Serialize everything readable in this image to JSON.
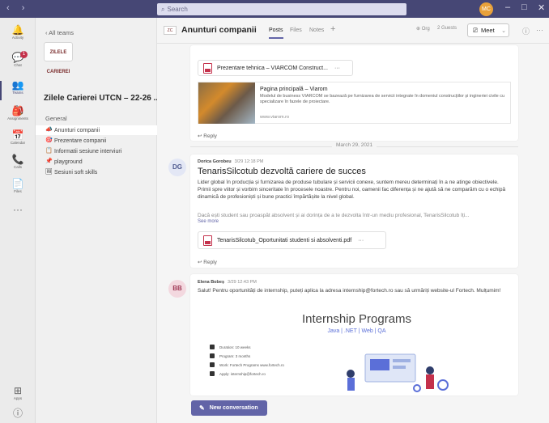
{
  "titlebar": {
    "search_placeholder": "Search",
    "user_initials": "MC"
  },
  "rail": [
    {
      "icon": "bell-icon",
      "glyph": "🔔",
      "label": "Activity"
    },
    {
      "icon": "chat-icon",
      "glyph": "💬",
      "label": "Chat",
      "badge": "1"
    },
    {
      "icon": "teams-icon",
      "glyph": "👥",
      "label": "Teams",
      "active": true
    },
    {
      "icon": "assignments-icon",
      "glyph": "🎒",
      "label": "Assignments"
    },
    {
      "icon": "calendar-icon",
      "glyph": "📅",
      "label": "Calendar"
    },
    {
      "icon": "calls-icon",
      "glyph": "📞",
      "label": "Calls"
    },
    {
      "icon": "files-icon",
      "glyph": "📄",
      "label": "Files"
    },
    {
      "icon": "more-icon",
      "glyph": "···",
      "label": ""
    },
    {
      "icon": "apps-icon",
      "glyph": "⊞",
      "label": "Apps"
    },
    {
      "icon": "help-icon",
      "glyph": "ⓘ",
      "label": "Help"
    }
  ],
  "panel": {
    "back_label": "All teams",
    "logo_text": "ZILELE CARIEREI",
    "team_name": "Zilele Carierei UTCN – 22-26 ...",
    "general_label": "General",
    "channels": [
      {
        "label": "Anunturi companii",
        "icon": "megaphone-icon",
        "glyph": "📣",
        "active": true
      },
      {
        "label": "Prezentare companii",
        "icon": "target-icon",
        "glyph": "🎯"
      },
      {
        "label": "Informatii sesiune interviuri",
        "icon": "clipboard-icon",
        "glyph": "📋"
      },
      {
        "label": "playground",
        "icon": "pin-icon",
        "glyph": "📌"
      },
      {
        "label": "Sesiuni soft skills",
        "icon": "image-icon",
        "glyph": "🖼"
      }
    ]
  },
  "header": {
    "channel_title": "Anunturi companii",
    "tabs": [
      "Posts",
      "Files",
      "Notes"
    ],
    "add_tab": "+",
    "chip_org": "Org",
    "chip_guests": "2 Guests",
    "meet_label": "Meet"
  },
  "messages": {
    "first": {
      "attachment": "Prezentare tehnica – VIARCOM Construct...",
      "preview_title": "Pagina principală – Viarom",
      "preview_desc": "Modelul de business VIARCOM se bazează pe furnizarea de servicii integrate în domeniul construcțiilor și ingineriei civile cu specializare în fazele de proiectare.",
      "preview_url": "www.viarom.ro",
      "reply": "Reply"
    },
    "date_separator": "March 29, 2021",
    "second": {
      "initials": "DG",
      "author": "Dorica Gorobeu",
      "time": "3/29 12:18 PM",
      "title": "TenarisSilcotub dezvoltă cariere de succes",
      "body_1": "Lider global în producția și furnizarea de produse tubulare și servicii conexe, suntem mereu determinați în a ne atinge obiectivele. Primii spre viitor și vorbim sinceritate în procesele noastre. Pentru noi, oamenii fac diferența și ne ajută să",
      "body_2": "ne comparăm cu o echipă dinamică de profesioniști și bune practici împărtășite la nivel global.",
      "body_3": "Dacă ești student sau proaspăt absolvent și ai dorința de a te dezvolta într-un mediu profesional, TenarisSilcotub îți...",
      "see_more": "See more",
      "attachment": "TenarisSilcotub_Oportunitati studenti si absolventi.pdf",
      "reply": "Reply"
    },
    "third": {
      "initials": "BB",
      "author": "Elena Bobeș",
      "time": "3/29 12:43 PM",
      "body": "Salut! Pentru oportunități de internship, puteți aplica la adresa internship@fortech.ro sau să urmăriți website-ul Fortech. Mulțumim!",
      "poster_title": "Internship Programs",
      "poster_sub": "Java | .NET | Web | QA",
      "poster_items": [
        "Duration: 10 weeks",
        "Program: 3 months",
        "Work: Fortech Programs www.fortech.ro",
        "Apply: internship@fortech.ro"
      ]
    }
  },
  "compose": {
    "new_conversation": "New conversation"
  },
  "colors": {
    "accent": "#6264a7",
    "titlebar": "#464775",
    "badge": "#c4314b"
  }
}
